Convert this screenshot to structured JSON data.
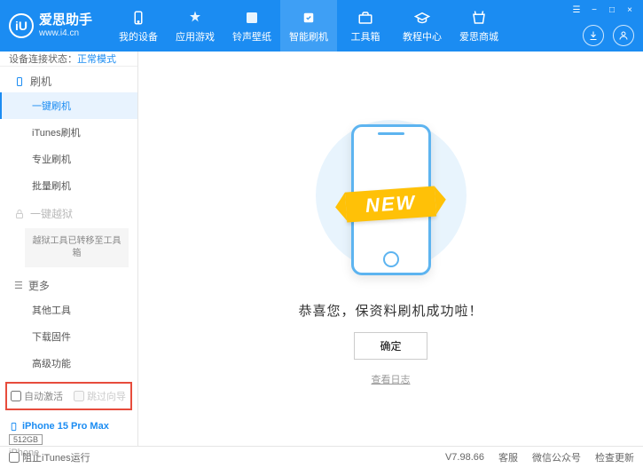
{
  "header": {
    "logo_letter": "iU",
    "app_name": "爱思助手",
    "url": "www.i4.cn",
    "nav": [
      {
        "label": "我的设备"
      },
      {
        "label": "应用游戏"
      },
      {
        "label": "铃声壁纸"
      },
      {
        "label": "智能刷机"
      },
      {
        "label": "工具箱"
      },
      {
        "label": "教程中心"
      },
      {
        "label": "爱思商城"
      }
    ]
  },
  "status": {
    "label": "设备连接状态：",
    "value": "正常模式"
  },
  "sidebar": {
    "section_flash": "刷机",
    "items_flash": [
      {
        "label": "一键刷机",
        "active": true
      },
      {
        "label": "iTunes刷机"
      },
      {
        "label": "专业刷机"
      },
      {
        "label": "批量刷机"
      }
    ],
    "section_jailbreak": "一键越狱",
    "jailbreak_note": "越狱工具已转移至工具箱",
    "section_more": "更多",
    "items_more": [
      {
        "label": "其他工具"
      },
      {
        "label": "下载固件"
      },
      {
        "label": "高级功能"
      }
    ],
    "auto_activate": "自动激活",
    "skip_guide": "跳过向导"
  },
  "device": {
    "name": "iPhone 15 Pro Max",
    "storage": "512GB",
    "type": "iPhone"
  },
  "main": {
    "banner": "NEW",
    "success": "恭喜您，保资料刷机成功啦！",
    "ok": "确定",
    "log": "查看日志"
  },
  "footer": {
    "block_itunes": "阻止iTunes运行",
    "version": "V7.98.66",
    "links": [
      "客服",
      "微信公众号",
      "检查更新"
    ]
  }
}
